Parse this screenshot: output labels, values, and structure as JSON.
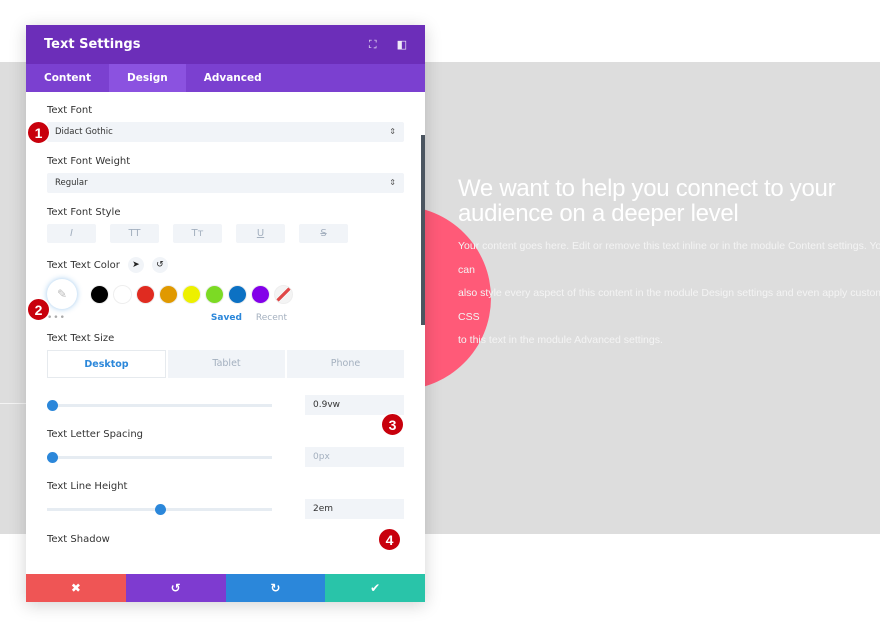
{
  "hero": {
    "title": "We want to help you connect to your audience on a deeper level",
    "body": "Your content goes here. Edit or remove this text inline or in the module Content settings. You can\nalso style every aspect of this content in the module Design settings and even apply custom CSS\nto this text in the module Advanced settings."
  },
  "modal": {
    "title": "Text Settings",
    "tabs": [
      {
        "label": "Content"
      },
      {
        "label": "Design"
      },
      {
        "label": "Advanced"
      }
    ],
    "active_tab": "Design"
  },
  "fields": {
    "font": {
      "label": "Text Font",
      "value": "Didact Gothic"
    },
    "weight": {
      "label": "Text Font Weight",
      "value": "Regular"
    },
    "style": {
      "label": "Text Font Style",
      "buttons": [
        "I",
        "TT",
        "Tт",
        "U",
        "S"
      ]
    },
    "color": {
      "label": "Text Text Color",
      "swatches": [
        "#000000",
        "#ffffff",
        "#e02b20",
        "#e09900",
        "#edf000",
        "#7cda24",
        "#0c71c3",
        "#8300e9"
      ],
      "saved": "Saved",
      "recent": "Recent",
      "more": "•••"
    },
    "size": {
      "label": "Text Text Size",
      "devices": [
        "Desktop",
        "Tablet",
        "Phone"
      ],
      "value": "0.9vw",
      "slider_percent": 2
    },
    "letter_spacing": {
      "label": "Text Letter Spacing",
      "value": "0px",
      "slider_percent": 2
    },
    "line_height": {
      "label": "Text Line Height",
      "value": "2em",
      "slider_percent": 50
    },
    "next": {
      "label": "Text Shadow"
    }
  },
  "badges": [
    "1",
    "2",
    "3",
    "4"
  ],
  "footer": {
    "colors": {
      "cancel": "#ef5555",
      "undo": "#7e3bd0",
      "redo": "#2b87da",
      "save": "#29c4a9"
    }
  }
}
